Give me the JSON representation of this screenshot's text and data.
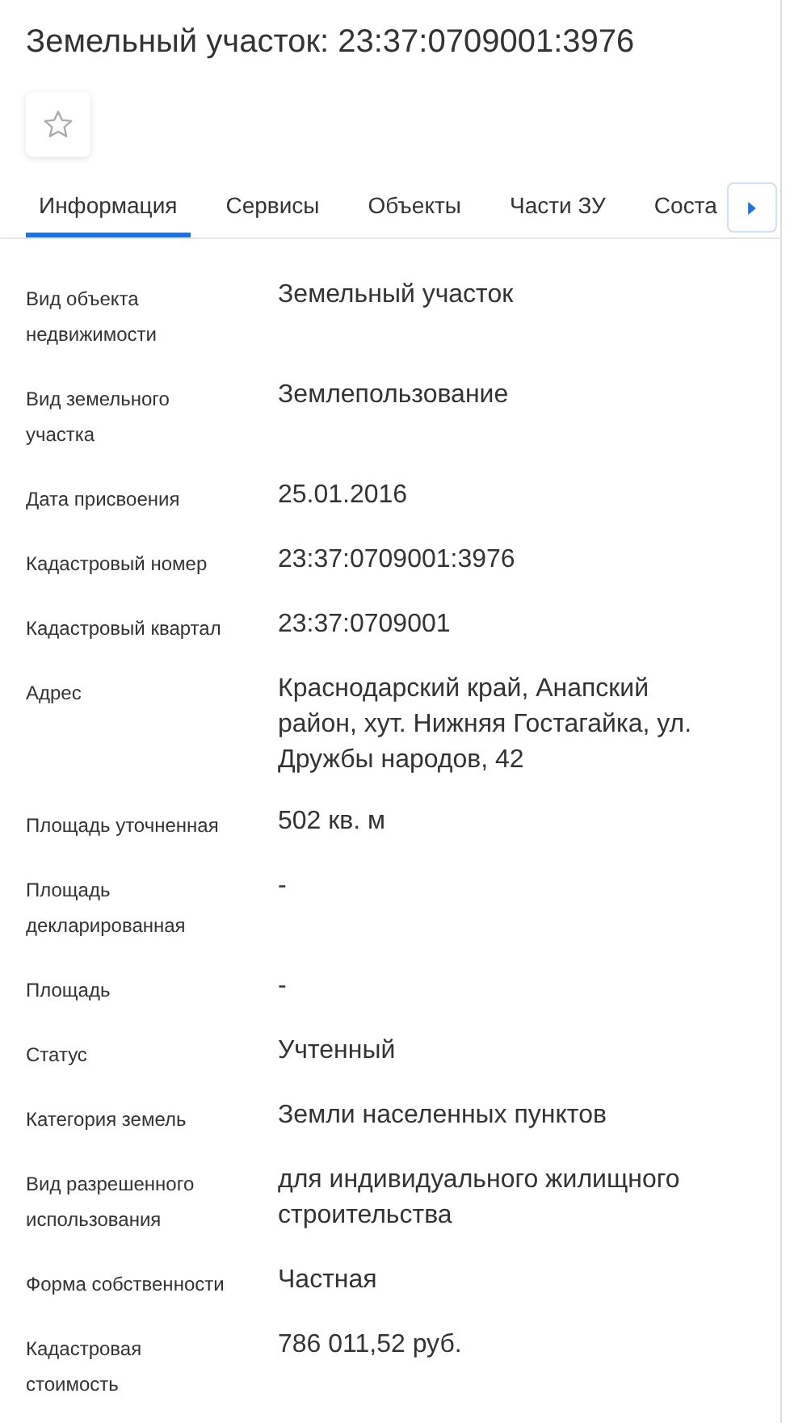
{
  "title": "Земельный участок: 23:37:0709001:3976",
  "favorite": {
    "on": false
  },
  "tabs": [
    {
      "label": "Информация",
      "selected": true
    },
    {
      "label": "Сервисы",
      "selected": false
    },
    {
      "label": "Объекты",
      "selected": false
    },
    {
      "label": "Части ЗУ",
      "selected": false
    },
    {
      "label": "Соста",
      "selected": false
    }
  ],
  "fields": [
    {
      "label": "Вид объекта недвижимости",
      "value": "Земельный участок"
    },
    {
      "label": "Вид земельного участка",
      "value": "Землепользование"
    },
    {
      "label": "Дата присвоения",
      "value": "25.01.2016"
    },
    {
      "label": "Кадастровый номер",
      "value": "23:37:0709001:3976"
    },
    {
      "label": "Кадастровый квартал",
      "value": "23:37:0709001"
    },
    {
      "label": "Адрес",
      "value": "Краснодарский край, Анапский район, хут. Нижняя Гостагайка, ул. Дружбы народов, 42"
    },
    {
      "label": "Площадь уточненная",
      "value": "502 кв. м"
    },
    {
      "label": "Площадь декларированная",
      "value": "-"
    },
    {
      "label": "Площадь",
      "value": "-"
    },
    {
      "label": "Статус",
      "value": "Учтенный"
    },
    {
      "label": "Категория земель",
      "value": "Земли населенных пунктов"
    },
    {
      "label": "Вид разрешенного использования",
      "value": "для индивидуального жилищного строительства"
    },
    {
      "label": "Форма собственности",
      "value": "Частная"
    },
    {
      "label": "Кадастровая стоимость",
      "value": "786 011,52 руб."
    }
  ]
}
